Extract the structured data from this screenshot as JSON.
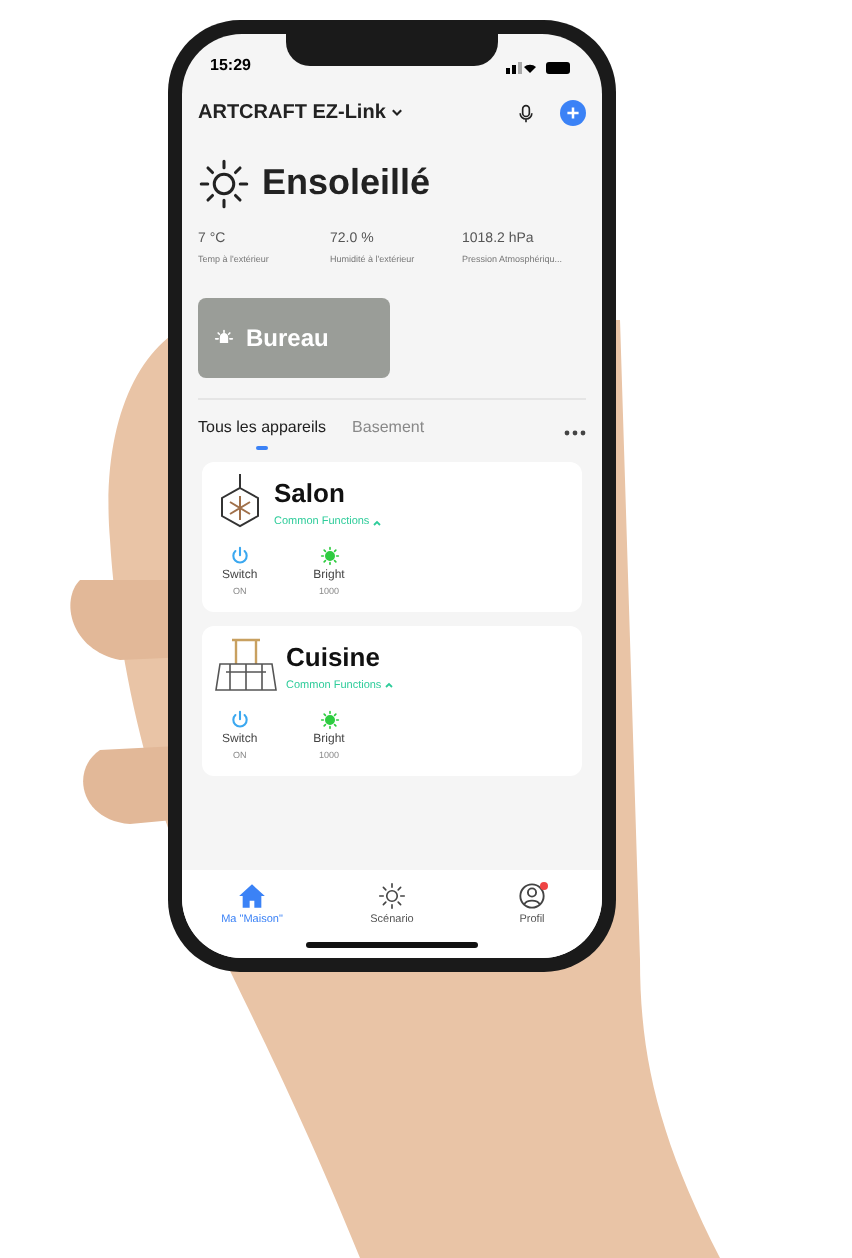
{
  "status_bar": {
    "time": "15:29"
  },
  "header": {
    "title": "ARTCRAFT EZ-Link"
  },
  "weather": {
    "condition": "Ensoleillé",
    "stats": [
      {
        "value": "7 °C",
        "label": "Temp à l'extérieur"
      },
      {
        "value": "72.0 %",
        "label": "Humidité à l'extérieur"
      },
      {
        "value": "1018.2 hPa",
        "label": "Pression Atmosphériqu..."
      }
    ]
  },
  "room_card": {
    "name": "Bureau"
  },
  "tabs": [
    {
      "label": "Tous les appareils",
      "selected": true
    },
    {
      "label": "Basement",
      "selected": false
    }
  ],
  "devices": [
    {
      "name": "Salon",
      "kind": "chandelier",
      "link": "Common Functions",
      "functions": [
        {
          "kind": "switch",
          "label": "Switch",
          "value": "ON"
        },
        {
          "kind": "bright",
          "label": "Bright",
          "value": "1000"
        }
      ]
    },
    {
      "name": "Cuisine",
      "kind": "hood",
      "link": "Common Functions",
      "functions": [
        {
          "kind": "switch",
          "label": "Switch",
          "value": "ON"
        },
        {
          "kind": "bright",
          "label": "Bright",
          "value": "1000"
        }
      ]
    }
  ],
  "nav": [
    {
      "kind": "home",
      "label": "Ma \"Maison\"",
      "selected": true,
      "notification": false
    },
    {
      "kind": "scene",
      "label": "Scénario",
      "selected": false,
      "notification": false
    },
    {
      "kind": "profile",
      "label": "Profil",
      "selected": false,
      "notification": true
    }
  ]
}
